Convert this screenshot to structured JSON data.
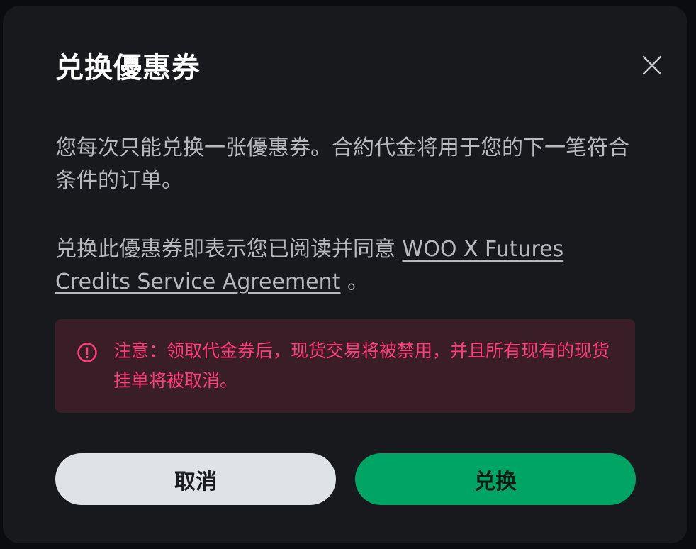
{
  "modal": {
    "title": "兑换優惠券",
    "close_icon": "close-icon",
    "description": "您每次只能兑换一张優惠券。合約代金将用于您的下一笔符合条件的订单。",
    "agreement_prefix": "兑换此優惠券即表示您已阅读并同意 ",
    "agreement_link": "WOO X Futures Credits Service Agreement",
    "agreement_suffix": " 。",
    "warning": {
      "icon": "alert-circle-icon",
      "text": "注意：领取代金券后，现货交易将被禁用，并且所有现有的现货挂单将被取消。"
    },
    "buttons": {
      "cancel": "取消",
      "confirm": "兑换"
    }
  },
  "colors": {
    "modal_bg": "#18191d",
    "warning_bg": "#3a1e27",
    "warning_text": "#ff3d7a",
    "confirm_bg": "#00a464",
    "cancel_bg": "#dfe2e6"
  }
}
